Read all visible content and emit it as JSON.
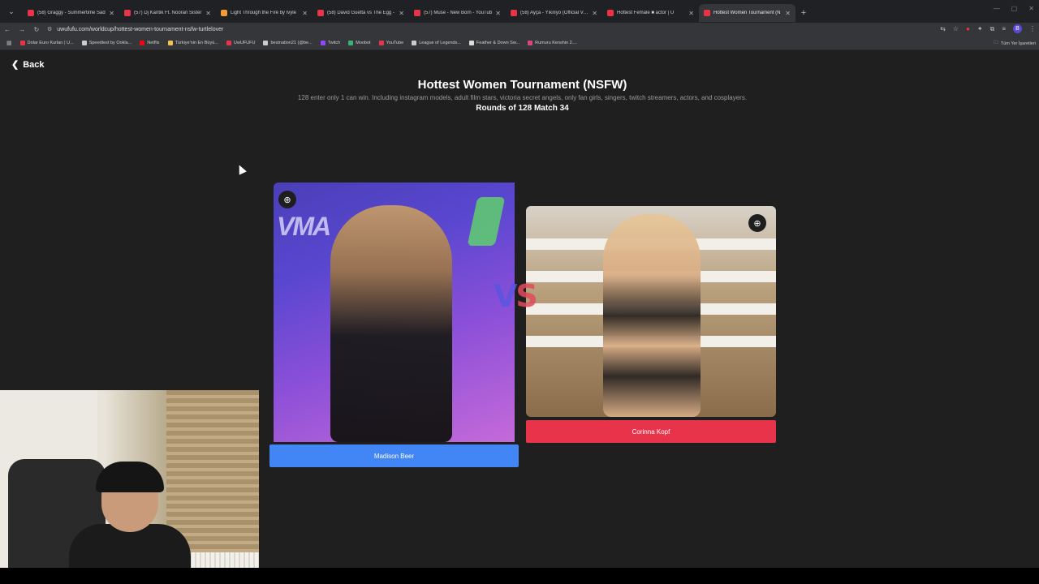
{
  "browser": {
    "tabs": [
      {
        "title": "(58) Graggy - Summertime Sad",
        "color": "#e8344a"
      },
      {
        "title": "(57) Dj Kantik Ft. Nooran Sister",
        "color": "#e8344a"
      },
      {
        "title": "Light Through the Fire by Ivyle",
        "color": "#f29c38"
      },
      {
        "title": "(58) David Guetta vs The Egg -",
        "color": "#e8344a"
      },
      {
        "title": "(57) Muse - New Born - YouTub",
        "color": "#e8344a"
      },
      {
        "title": "(58) Ayça - Yıkılıyo (Official Vide",
        "color": "#e8344a"
      },
      {
        "title": "Hottest Female ■ actor | U",
        "color": "#e8344a"
      },
      {
        "title": "Hottest Women Tournament (N",
        "color": "#e8344a"
      }
    ],
    "url": "uwufufu.com/worldcup/hottest-women-tournament-nsfw-turtlelover",
    "profile_initial": "B",
    "bookmarks": [
      {
        "label": "Dolar Euro Kurları | U...",
        "color": "#e8344a"
      },
      {
        "label": "Speedtest by Ookla...",
        "color": "#cccccc"
      },
      {
        "label": "Netflix",
        "color": "#e50914"
      },
      {
        "label": "Türkiye'nin En Büyü...",
        "color": "#f2c14e"
      },
      {
        "label": "UwUFUFU",
        "color": "#e8344a"
      },
      {
        "label": "bestnation21 (@be...",
        "color": "#cccccc"
      },
      {
        "label": "Twitch",
        "color": "#9146ff"
      },
      {
        "label": "Moobot",
        "color": "#3bb273"
      },
      {
        "label": "YouTube",
        "color": "#e8344a"
      },
      {
        "label": "League of Legends...",
        "color": "#cccccc"
      },
      {
        "label": "Feather & Down Sw...",
        "color": "#dddddd"
      },
      {
        "label": "Rumuru Kenshin 2....",
        "color": "#d9467a"
      }
    ],
    "bookmarks_folder": "Tüm Yer İşaretleri"
  },
  "page": {
    "back_label": "Back",
    "title": "Hottest Women Tournament (NSFW)",
    "description": "128 enter only 1 can win. Including instagram models, adult film stars, victoria secret angels, only fan girls, singers, twitch streamers, actors, and cosplayers.",
    "round_info": "Rounds of 128 Match 34",
    "vs_v": "V",
    "vs_s": "S",
    "left": {
      "name": "Madison Beer",
      "button_color": "#4285f4"
    },
    "right": {
      "name": "Corinna Kopf",
      "button_color": "#e8344a"
    },
    "photo_text": "VMA"
  }
}
